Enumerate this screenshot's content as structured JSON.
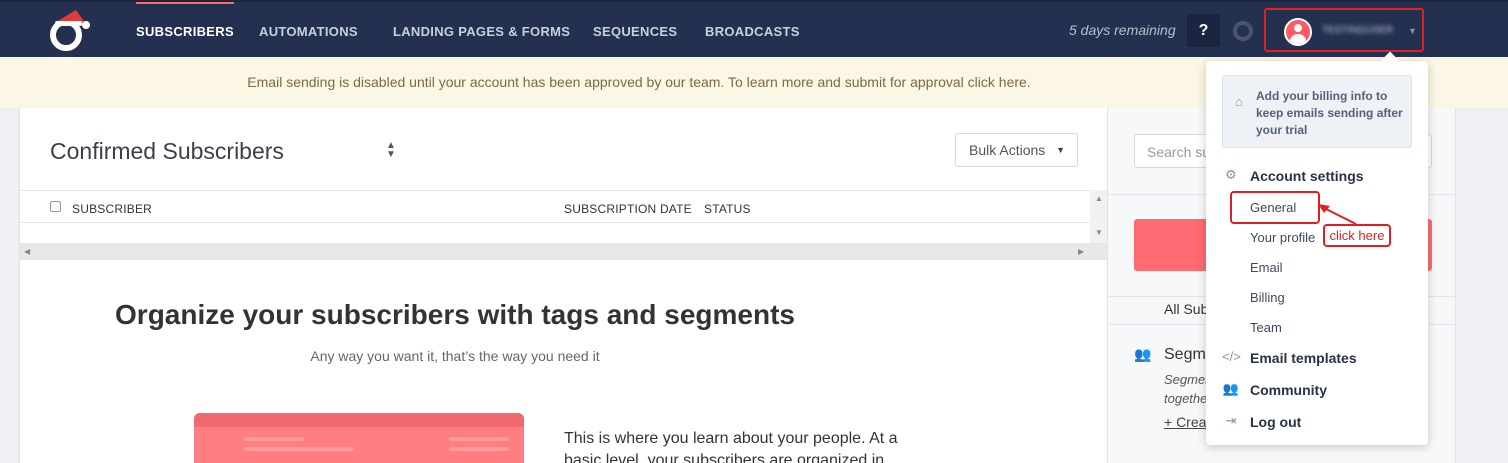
{
  "nav": {
    "items": [
      "SUBSCRIBERS",
      "AUTOMATIONS",
      "LANDING PAGES & FORMS",
      "SEQUENCES",
      "BROADCASTS"
    ],
    "trial": "5 days remaining",
    "help": "?",
    "account_name": "TESTINGUSER"
  },
  "banner": {
    "text": "Email sending is disabled until your account has been approved by our team. To learn more and submit for approval click here."
  },
  "main": {
    "title": "Confirmed Subscribers",
    "bulk_actions": "Bulk Actions",
    "columns": [
      "SUBSCRIBER",
      "SUBSCRIPTION DATE",
      "STATUS"
    ],
    "empty_title": "Organize your subscribers with tags and segments",
    "empty_sub": "Any way you want it, that’s the way you need it",
    "learn_text": "This is where you learn about your people. At a basic level, your subscribers are organized in"
  },
  "sidebar": {
    "search_placeholder": "Search su",
    "all_subs": "All Sub",
    "segments": "Segme",
    "seg_line1": "Segmen",
    "seg_line2": "togethe",
    "create": "+ Creat"
  },
  "dropdown": {
    "billing_note": "Add your billing info to keep emails sending after your trial",
    "account_settings": "Account settings",
    "sub_items": [
      "General",
      "Your profile",
      "Email",
      "Billing",
      "Team"
    ],
    "email_templates": "Email templates",
    "community": "Community",
    "logout": "Log out"
  },
  "annotation": {
    "callout": "click here",
    "color": "#e01f24"
  }
}
